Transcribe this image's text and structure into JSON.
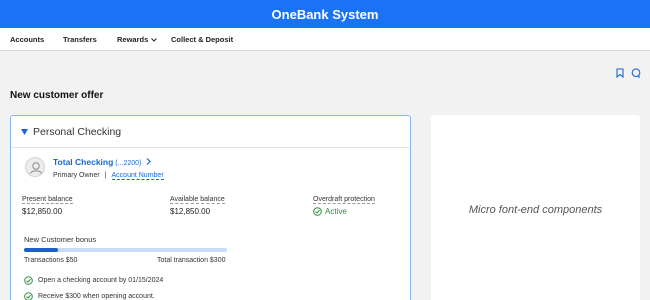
{
  "app": {
    "title": "OneBank System"
  },
  "nav": {
    "items": [
      {
        "label": "Accounts"
      },
      {
        "label": "Transfers"
      },
      {
        "label": "Rewards"
      },
      {
        "label": "Collect & Deposit"
      }
    ]
  },
  "page": {
    "title": "New customer offer"
  },
  "checking_card": {
    "title": "Personal Checking",
    "account_name": "Total Checking",
    "account_mask": "(...2200)",
    "owner": "Primary Owner",
    "separator": "|",
    "account_number_link": "Account Number",
    "present_balance_label": "Present balance",
    "present_balance_value": "$12,850.00",
    "available_balance_label": "Available balance",
    "available_balance_value": "$12,850.00",
    "overdraft_label": "Overdraft protection",
    "overdraft_value": "Active",
    "bonus": {
      "title": "New Customer bonus",
      "progress_fraction": 0.1667,
      "left_label": "Transactions $50",
      "right_label": "Total transaction $300"
    },
    "requirements": [
      {
        "text": "Open a checking account by 01/15/2024"
      },
      {
        "text": "Receive $300 when opening account."
      }
    ]
  },
  "side_card": {
    "text": "Micro font-end components"
  },
  "colors": {
    "brand": "#1a73f5",
    "link": "#1a66d2",
    "success": "#2e8b3e",
    "progress": "#1a5fcc"
  },
  "icons": [
    "bookmark-icon",
    "chat-icon",
    "chevron-down-icon",
    "triangle-down-icon",
    "user-icon",
    "chevron-right-icon",
    "check-circle-icon"
  ]
}
